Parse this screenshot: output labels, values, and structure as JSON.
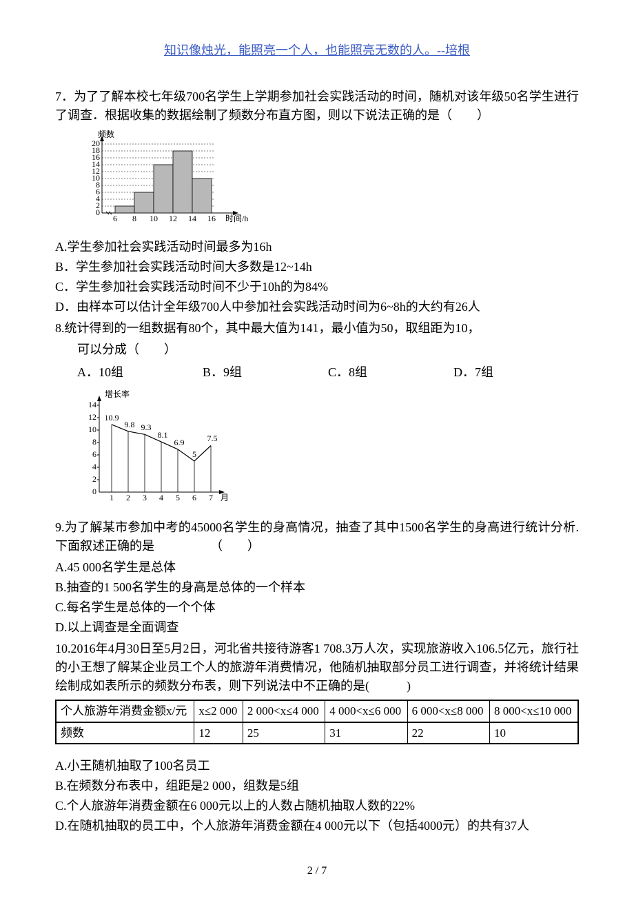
{
  "header_quote": "知识像烛光，能照亮一个人，也能照亮无数的人。--培根",
  "q7": {
    "stem": "7．为了了解本校七年级700名学生上学期参加社会实践活动的时间，随机对该年级50名学生进行了调查．根据收集的数据绘制了频数分布直方图，则以下说法正确的是（　　）",
    "optA": "A.学生参加社会实践活动时间最多为16h",
    "optB": "B．学生参加社会实践活动时间大多数是12~14h",
    "optC": "C．学生参加社会实践活动时间不少于10h的为84%",
    "optD": "D．由样本可以估计全年级700人中参加社会实践活动时间为6~8h的大约有26人"
  },
  "q8": {
    "stem": "8.统计得到的一组数据有80个，其中最大值为141，最小值为50，取组距为10，",
    "stem2": "可以分成（　　）",
    "optA": "A．10组",
    "optB": "B．9组",
    "optC": "C．8组",
    "optD": "D．7组"
  },
  "q9": {
    "stem": "9.为了解某市参加中考的45000名学生的身高情况，抽查了其中1500名学生的身高进行统计分析.下面叙述正确的是　　　　　（　　）",
    "optA": "A.45 000名学生是总体",
    "optB": "B.抽查的1 500名学生的身高是总体的一个样本",
    "optC": "C.每名学生是总体的一个个体",
    "optD": "D.以上调查是全面调查"
  },
  "q10": {
    "stem": "10.2016年4月30日至5月2日，河北省共接待游客1 708.3万人次，实现旅游收入106.5亿元，旅行社的小王想了解某企业员工个人的旅游年消费情况，他随机抽取部分员工进行调查，并将统计结果绘制成如表所示的频数分布表，则下列说法中不正确的是(　　　)",
    "optA": "A.小王随机抽取了100名员工",
    "optB": "B.在频数分布表中，组距是2 000，组数是5组",
    "optC": "C.个人旅游年消费金额在6 000元以上的人数占随机抽取人数的22%",
    "optD": "D.在随机抽取的员工中，个人旅游年消费金额在4 000元以下（包括4000元）的共有37人"
  },
  "table": {
    "header": "个人旅游年消费金额x/元",
    "ranges": [
      "x≤2 000",
      "2 000<x≤4 000",
      "4 000<x≤6 000",
      "6 000<x≤8 000",
      "8 000<x≤10 000"
    ],
    "freq_label": "频数",
    "freqs": [
      "12",
      "25",
      "31",
      "22",
      "10"
    ]
  },
  "page_number": "2 / 7",
  "chart_data": [
    {
      "type": "bar",
      "title": "",
      "xlabel": "时间/h",
      "ylabel": "频数",
      "categories": [
        "6-8",
        "8-10",
        "10-12",
        "12-14",
        "14-16"
      ],
      "values": [
        2,
        6,
        14,
        18,
        10
      ],
      "ylim": [
        0,
        20
      ],
      "yticks": [
        0,
        2,
        4,
        6,
        8,
        10,
        12,
        14,
        16,
        18,
        20
      ]
    },
    {
      "type": "line",
      "title": "",
      "xlabel": "月",
      "ylabel": "增长率",
      "x": [
        1,
        2,
        3,
        4,
        5,
        6,
        7
      ],
      "values": [
        10.9,
        9.8,
        9.3,
        8.1,
        6.9,
        5,
        7.5
      ],
      "ylim": [
        0,
        14
      ],
      "yticks": [
        0,
        2,
        4,
        6,
        8,
        10,
        12,
        14
      ]
    }
  ]
}
